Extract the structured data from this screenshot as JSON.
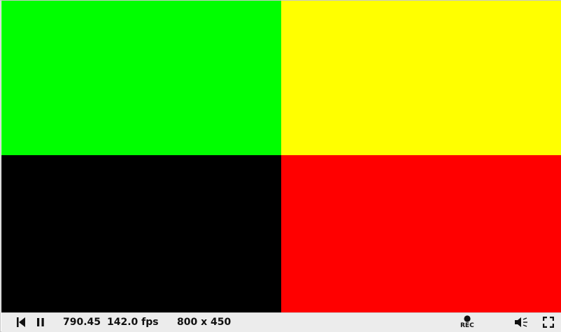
{
  "canvas": {
    "quadrants": [
      {
        "name": "top-left",
        "color": "#00ff00"
      },
      {
        "name": "top-right",
        "color": "#ffff00"
      },
      {
        "name": "bottom-left",
        "color": "#000000"
      },
      {
        "name": "bottom-right",
        "color": "#ff0000"
      }
    ]
  },
  "controls": {
    "time": "790.45",
    "fps": "142.0 fps",
    "resolution": "800 x 450",
    "rec_label": "REC",
    "icons": {
      "restart": "skip-back-icon",
      "pause": "pause-icon",
      "record": "record-icon",
      "volume": "volume-icon",
      "fullscreen": "fullscreen-icon"
    }
  }
}
